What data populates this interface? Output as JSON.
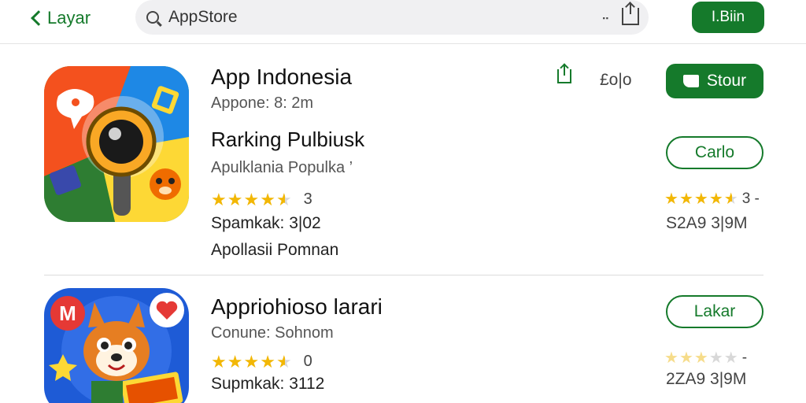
{
  "header": {
    "back_label": "Layar",
    "search_value": "AppStore",
    "search_placeholder": "AppStore",
    "action_button": "I.Biin"
  },
  "apps": [
    {
      "title": "App Indonesia",
      "subtitle": "Appone: 8: 2m",
      "price": "£o|o",
      "primary_button": "Stour",
      "heading2": "Rarking Pulbiusk",
      "category": "Apulklania Populka ’",
      "rating_stars": 4.5,
      "rating_count": "3",
      "meta": "Spamkak: 3|02",
      "extra": "Apollasii Pomnan",
      "secondary_button": "Carlo",
      "right_rating_stars": 4.5,
      "right_rating_count": "3 -",
      "right_size": "S2A9 3|9M"
    },
    {
      "title": "Appriohioso larari",
      "subtitle": "Conune: Sohnom",
      "rating_stars": 4.5,
      "rating_count": "0",
      "meta": "Supmkak: 3112",
      "secondary_button": "Lakar",
      "right_rating_stars": 3.5,
      "right_rating_count": "-",
      "right_size": "2ZA9 3|9M"
    }
  ],
  "colors": {
    "accent": "#157a2b",
    "star": "#f2b705",
    "star_off": "#d8d8d8"
  }
}
